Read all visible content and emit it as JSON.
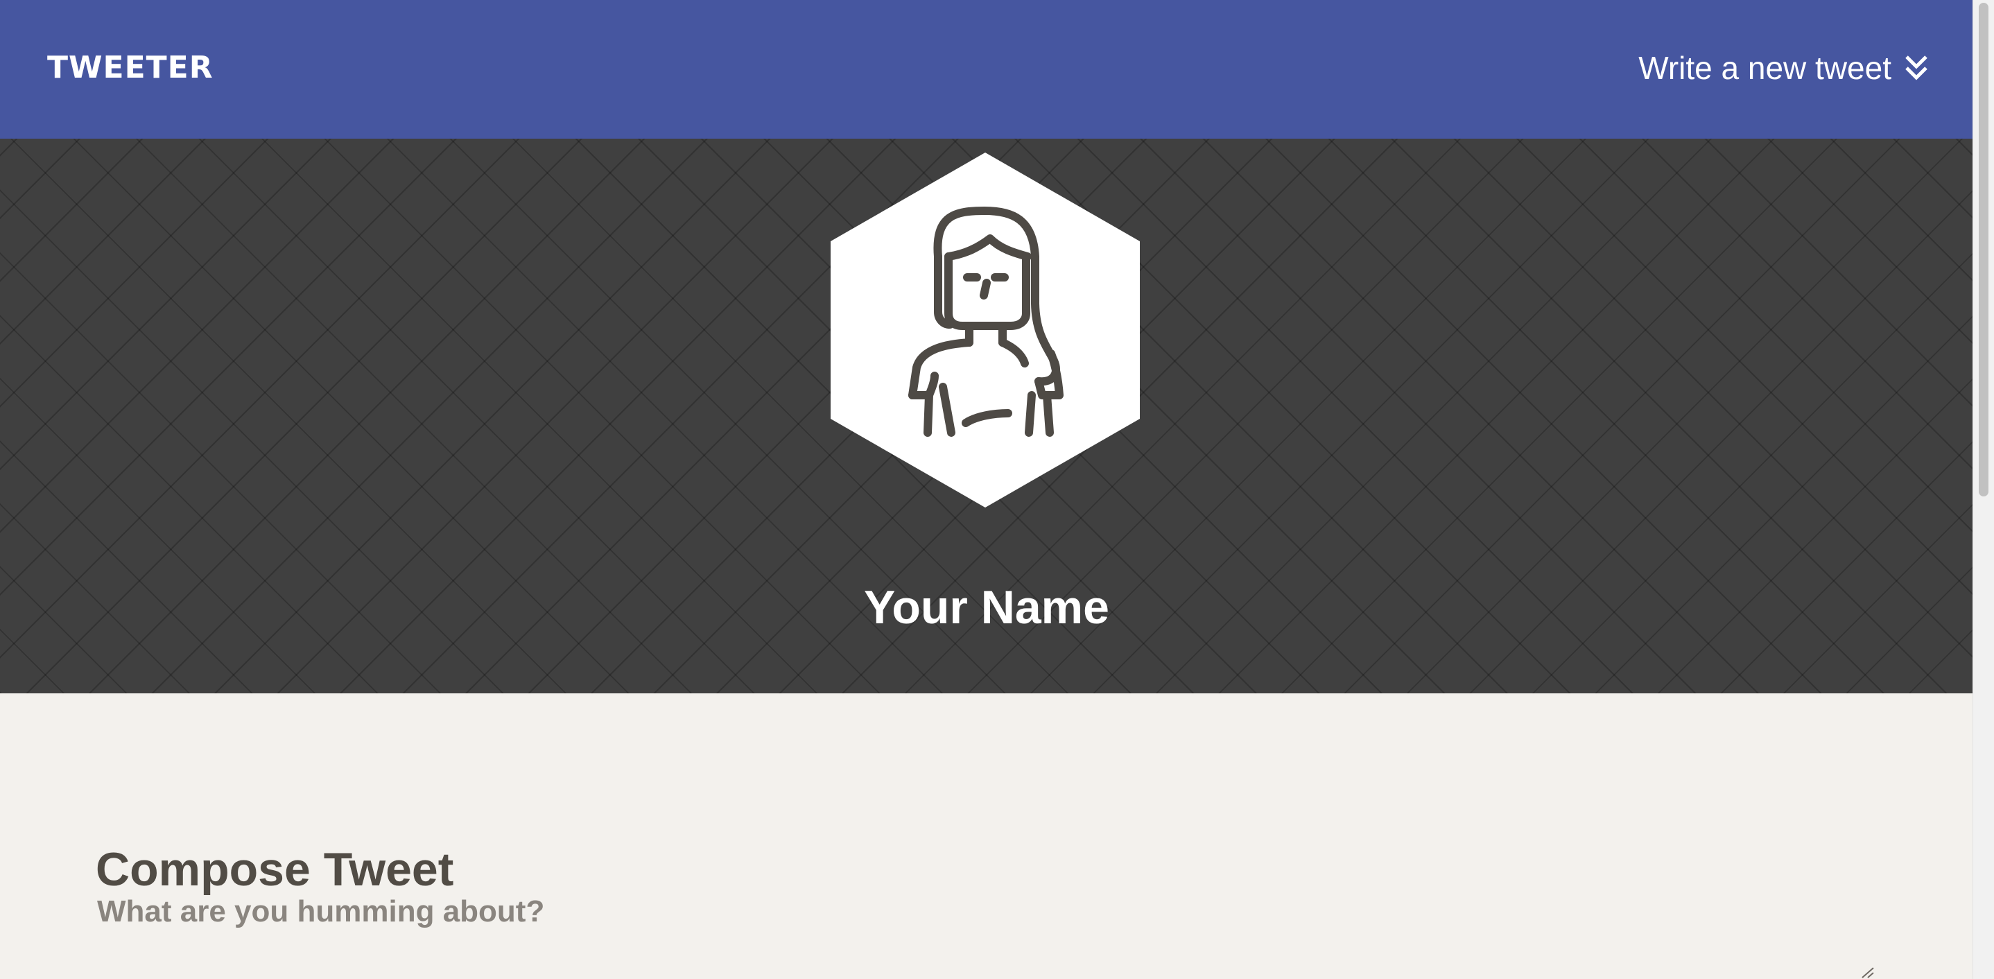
{
  "nav": {
    "brand": "TWEETER",
    "new_tweet_label": "Write a new tweet",
    "new_tweet_icon": "double-chevron-down-icon"
  },
  "profile": {
    "avatar_icon": "woman-avatar-icon",
    "name": "Your Name"
  },
  "compose": {
    "title": "Compose Tweet",
    "placeholder": "What are you humming about?",
    "value": ""
  },
  "colors": {
    "nav_bg": "#4656a0",
    "banner_bg": "#404040",
    "page_bg": "#f3f1ed",
    "heading_text": "#514c45",
    "placeholder_text": "#8a857f"
  }
}
